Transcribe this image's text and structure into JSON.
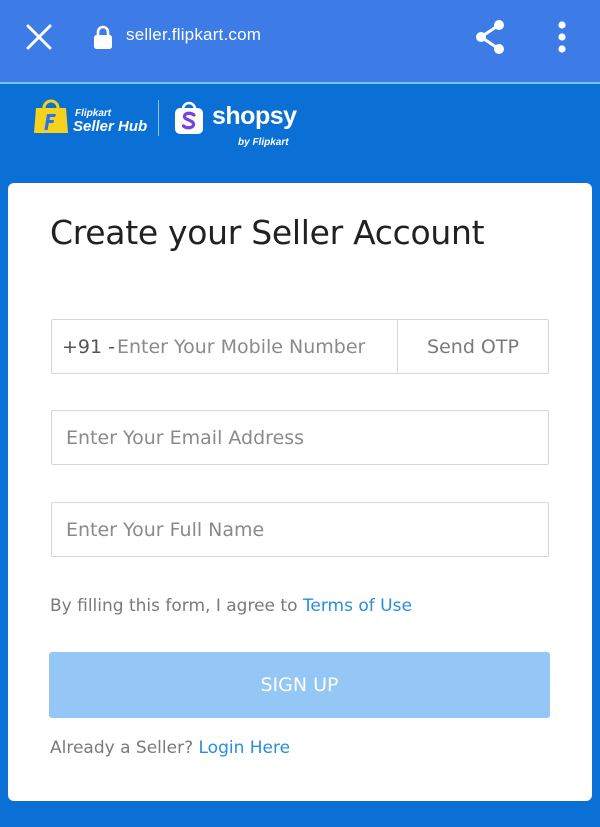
{
  "browser": {
    "url": "seller.flipkart.com",
    "icons": {
      "close": "close-icon",
      "lock": "lock-icon",
      "share": "share-icon",
      "menu": "more-vert-icon"
    }
  },
  "brand": {
    "flipkart_small": "Flipkart",
    "flipkart_big": "Seller Hub",
    "shopsy_name": "shopsy",
    "shopsy_by": "by Flipkart"
  },
  "form": {
    "title": "Create your Seller Account",
    "phone_prefix": "+91 -",
    "mobile_placeholder": "Enter Your Mobile Number",
    "send_otp_label": "Send OTP",
    "email_placeholder": "Enter Your Email Address",
    "name_placeholder": "Enter Your Full Name",
    "terms_text": "By filling this form, I agree to",
    "terms_link": "Terms of Use",
    "signup_label": "SIGN UP",
    "login_text": "Already a Seller?",
    "login_link": "Login Here"
  },
  "colors": {
    "browser_bar": "#3d7be6",
    "page_background": "#0a70d6",
    "signup_button": "#94c6f6",
    "link": "#2a8ce0"
  }
}
